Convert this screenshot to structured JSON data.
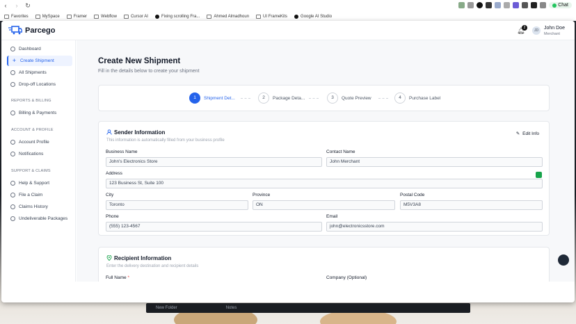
{
  "browser": {
    "nav": {
      "back": "‹",
      "forward": "›",
      "reload": "↻"
    },
    "chat_label": "Chat",
    "bookmarks": [
      "Favorites",
      "MySpace",
      "Framer",
      "Webflow",
      "Cursor AI",
      "Fixing scrolling Fra...",
      "Ahmed Almadhoun",
      "UI FrameKits",
      "Google AI Studio"
    ]
  },
  "header": {
    "brand": "Parcego",
    "notification_count": "2",
    "user": {
      "initials": "JD",
      "name": "John Doe",
      "role": "Merchant"
    }
  },
  "sidebar": {
    "items_main": [
      {
        "label": "Dashboard",
        "icon": "home-icon"
      },
      {
        "label": "Create Shipment",
        "icon": "plus-icon"
      },
      {
        "label": "All Shipments",
        "icon": "list-icon"
      },
      {
        "label": "Drop-off Locations",
        "icon": "location-icon"
      }
    ],
    "section_reports": "REPORTS & BILLING",
    "items_reports": [
      {
        "label": "Billing & Payments",
        "icon": "card-icon"
      }
    ],
    "section_account": "ACCOUNT & PROFILE",
    "items_account": [
      {
        "label": "Account Profile",
        "icon": "user-icon"
      },
      {
        "label": "Notifications",
        "icon": "bell-icon"
      }
    ],
    "section_support": "SUPPORT & CLAIMS",
    "items_support": [
      {
        "label": "Help & Support",
        "icon": "help-icon"
      },
      {
        "label": "File a Claim",
        "icon": "file-icon"
      },
      {
        "label": "Claims History",
        "icon": "history-icon"
      },
      {
        "label": "Undeliverable Packages",
        "icon": "package-icon"
      }
    ]
  },
  "page": {
    "title": "Create New Shipment",
    "subtitle": "Fill in the details below to create your shipment"
  },
  "stepper": [
    {
      "num": "1",
      "label": "Shipment Det..."
    },
    {
      "num": "2",
      "label": "Package Deta..."
    },
    {
      "num": "3",
      "label": "Quote Preview"
    },
    {
      "num": "4",
      "label": "Purchase Label"
    }
  ],
  "sender": {
    "title": "Sender Information",
    "subtitle": "This information is automatically filled from your business profile",
    "edit_label": "Edit Info",
    "fields": {
      "business_name": {
        "label": "Business Name",
        "value": "John's Electronics Store"
      },
      "contact_name": {
        "label": "Contact Name",
        "value": "John Merchant"
      },
      "address": {
        "label": "Address",
        "value": "123 Business St, Suite 100"
      },
      "city": {
        "label": "City",
        "value": "Toronto"
      },
      "province": {
        "label": "Province",
        "value": "ON"
      },
      "postal_code": {
        "label": "Postal Code",
        "value": "M5V3A8"
      },
      "phone": {
        "label": "Phone",
        "value": "(555) 123-4567"
      },
      "email": {
        "label": "Email",
        "value": "john@electronicsstore.com"
      }
    }
  },
  "recipient": {
    "title": "Recipient Information",
    "subtitle": "Enter the delivery destination and recipient details",
    "full_name_label": "Full Name",
    "required_mark": "*",
    "company_label": "Company (Optional)"
  },
  "dock": {
    "item1": "New Folder",
    "item2": "Notes"
  },
  "colors": {
    "accent": "#2563eb",
    "success": "#16a34a",
    "sidebar_active_bg": "#eef3ff"
  }
}
